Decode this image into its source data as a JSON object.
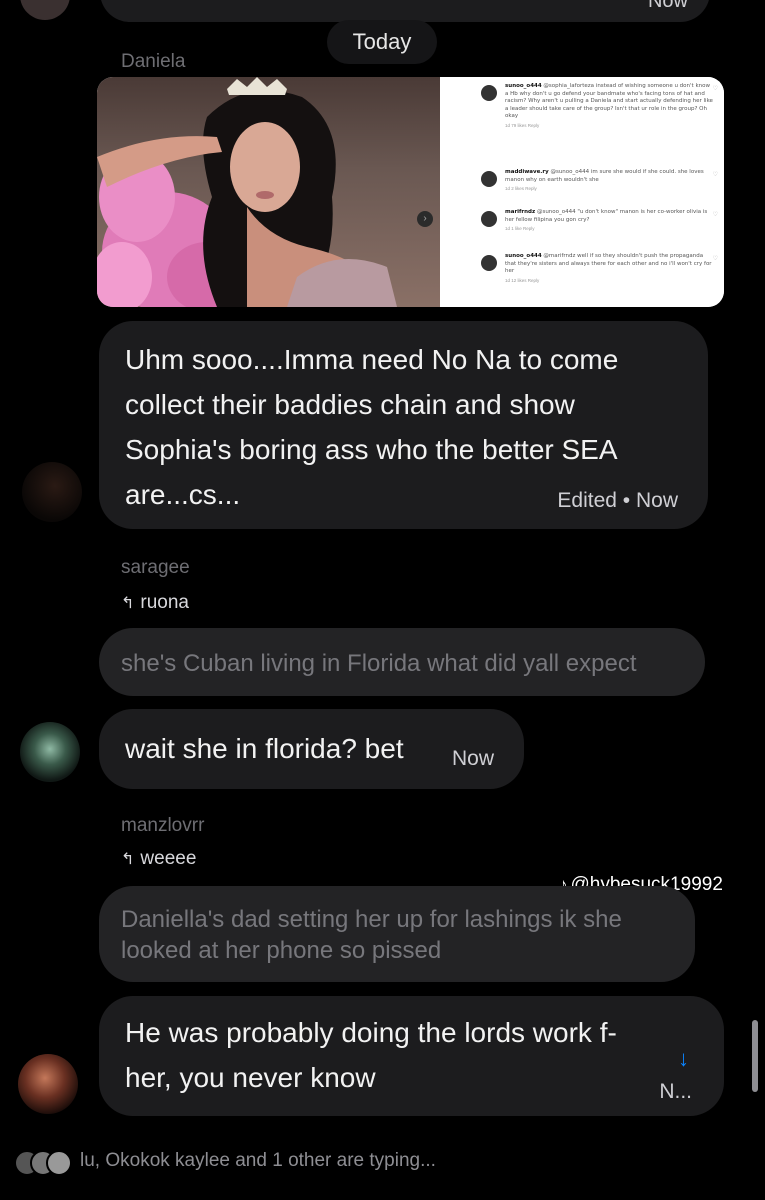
{
  "top": {
    "partial_time": "Now"
  },
  "date_divider": "Today",
  "messages": [
    {
      "sender": "Daniela",
      "image_post": {
        "comments": [
          {
            "user": "sunoo_o444",
            "text": "@sophia_laforteza instead of wishing someone u don't know a Hb why don't u go defend your bandmate who's facing tons of hat and racism? Why aren't u pulling a Daniela and start actually defending her like a leader should take care of the group? Isn't that ur role in the group? Oh okay",
            "foot": "1d  79 likes  Reply"
          },
          {
            "user": "maddiwave.ry",
            "text": "@sunoo_o444 im sure she would if she could. she loves manon why on earth wouldn't she",
            "foot": "1d  2 likes  Reply"
          },
          {
            "user": "marifrndz",
            "text": "@sunoo_o444 \"u don't know\" manon is her co-worker olivia is her fellow filipina you gon cry?",
            "foot": "1d  1 like  Reply"
          },
          {
            "user": "sunoo_o444",
            "text": "@marifrndz well if so they shouldn't push the propaganda that they're sisters and always there for each other and no i'll won't cry for her",
            "foot": "1d  12 likes  Reply"
          }
        ]
      },
      "text": "Uhm sooo....Imma need No Na to come collect their baddies chain and show Sophia's boring ass who the better SEA are...cs...",
      "edited": "Edited",
      "time": "Now"
    },
    {
      "sender": "saragee",
      "reply_to": "ruona",
      "quoted": "she's Cuban living in Florida what did yall expect",
      "text": "wait she in florida? bet",
      "time": "Now"
    },
    {
      "sender": "manzlovrr",
      "reply_to": "weeee",
      "quoted": "Daniella's dad setting her up for lashings ik she looked at her phone so pissed",
      "text": "He was probably doing the lords work f-\nher, you never know",
      "time": "N..."
    }
  ],
  "watermark": "@hybesuck19992",
  "typing_indicator": "lu, Okokok kaylee and 1 other are typing...",
  "colors": {
    "bubble": "#1c1c1e",
    "accent": "#0a84ff",
    "muted": "#6e6e73"
  }
}
